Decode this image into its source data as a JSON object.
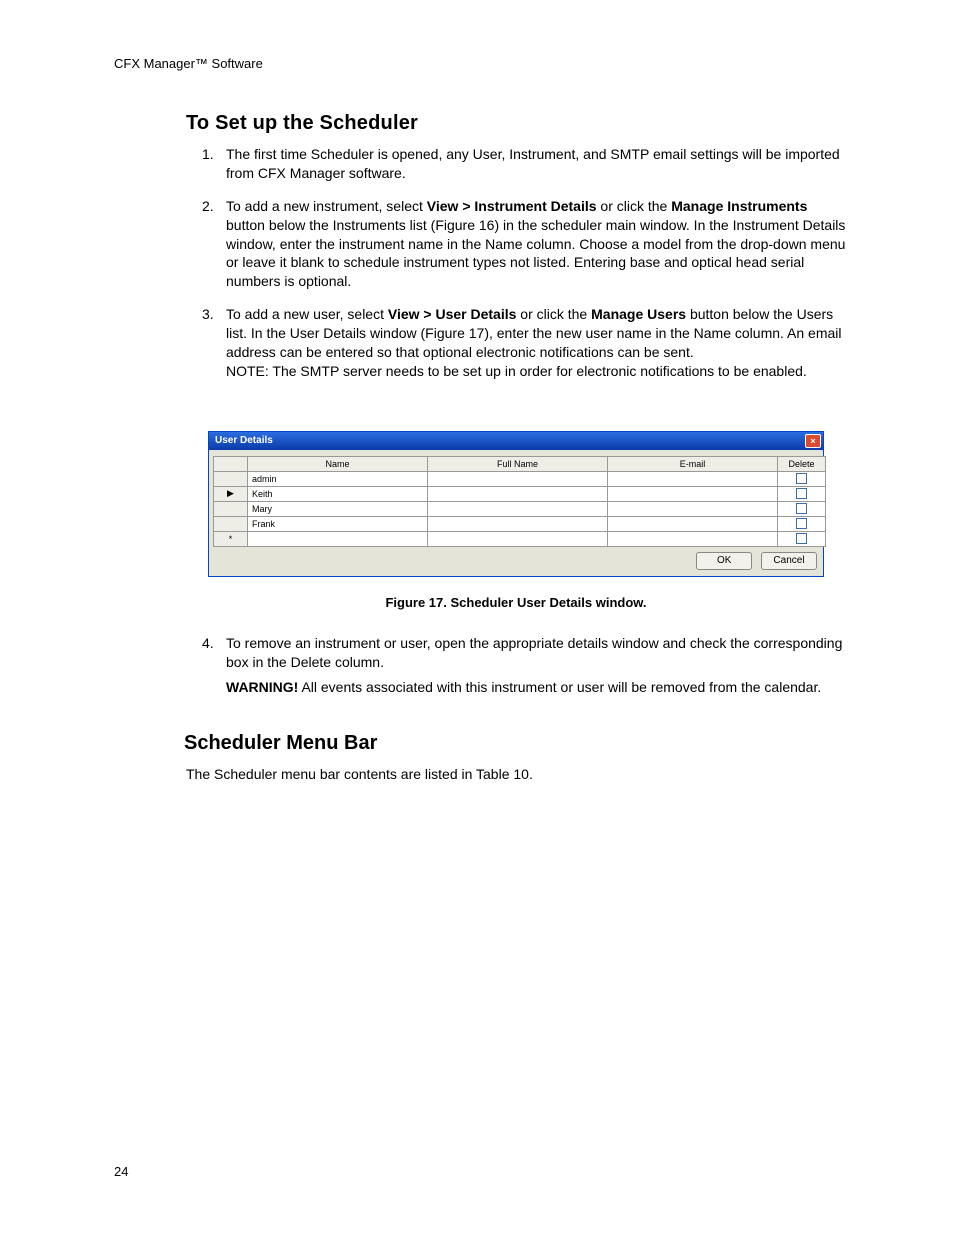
{
  "header": {
    "product": "CFX Manager™ Software"
  },
  "page_number": "24",
  "section1": {
    "title": "To Set up the Scheduler",
    "items": [
      {
        "text": "The first time Scheduler is opened, any User, Instrument, and SMTP email settings will be imported from CFX Manager software."
      },
      {
        "pre1": "To add a new instrument, select ",
        "b1": "View > Instrument Details",
        "mid1": " or click the ",
        "b2": "Manage Instruments",
        "post1": " button below the Instruments list (Figure 16) in the scheduler main window. In the Instrument Details window, enter the instrument name in the Name column. Choose a model from the drop-down menu or leave it blank to schedule instrument types not listed. Entering base and optical head serial numbers is optional."
      },
      {
        "pre1": "To add a new user, select ",
        "b1": "View > User Details",
        "mid1": " or click the ",
        "b2": "Manage Users",
        "post1": " button below the Users list. In the User Details window (Figure 17), enter the new user name in the Name column. An email address can be entered so that optional electronic notifications can be sent.",
        "note": "NOTE: The SMTP server needs to be set up in order for electronic notifications to be enabled."
      }
    ],
    "item4": {
      "text": "To remove an instrument or user, open the appropriate details window and check the corresponding box in the Delete column.",
      "warn_label": "WARNING!",
      "warn_text": " All events associated with this instrument or user will be removed from the calendar."
    }
  },
  "figure": {
    "window_title": "User Details",
    "close": "×",
    "headers": {
      "rowhdr": "",
      "name": "Name",
      "fullname": "Full Name",
      "email": "E-mail",
      "delete": "Delete"
    },
    "rows": [
      {
        "sel": "",
        "name": "admin",
        "fullname": "",
        "email": ""
      },
      {
        "sel": "▶",
        "name": "Keith",
        "fullname": "",
        "email": ""
      },
      {
        "sel": "",
        "name": "Mary",
        "fullname": "",
        "email": ""
      },
      {
        "sel": "",
        "name": "Frank",
        "fullname": "",
        "email": ""
      },
      {
        "sel": "*",
        "name": "",
        "fullname": "",
        "email": ""
      }
    ],
    "buttons": {
      "ok": "OK",
      "cancel": "Cancel"
    },
    "caption": "Figure 17. Scheduler User Details window."
  },
  "section2": {
    "title": "Scheduler Menu Bar",
    "para": "The Scheduler menu bar contents are listed in Table 10."
  }
}
